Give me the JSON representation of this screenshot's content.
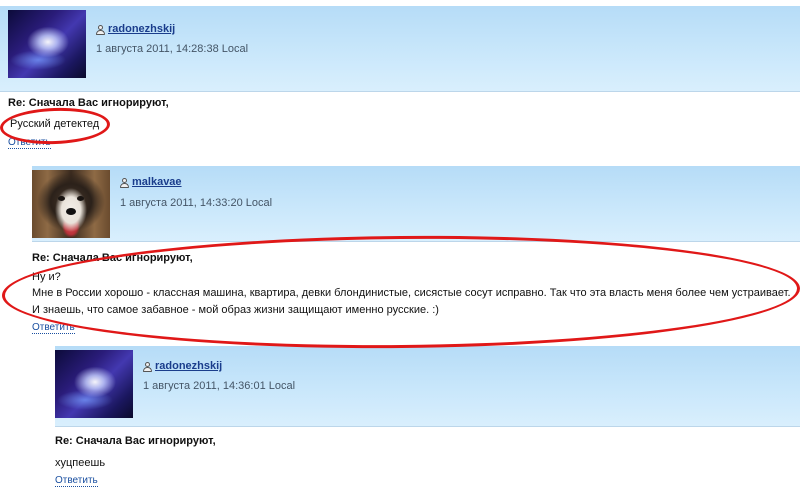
{
  "comments": [
    {
      "username": "radonezhskij",
      "timestamp": "1 августа 2011, 14:28:38 Local",
      "title": "Re: Сначала Вас игнорируют,",
      "body": [
        "Русский детектед"
      ],
      "reply": "Ответить",
      "avatar": "nebula-hand-avatar"
    },
    {
      "username": "malkavae",
      "timestamp": "1 августа 2011, 14:33:20 Local",
      "title": "Re: Сначала Вас игнорируют,",
      "body": [
        "Ну и?",
        "Мне в России хорошо - классная машина, квартира, девки блондинистые, сисястые сосут исправно. Так что эта власть меня более чем устраивает.",
        "И знаешь, что самое забавное - мой образ жизни защищают именно русские. :)"
      ],
      "reply": "Ответить",
      "avatar": "husky-dog-avatar"
    },
    {
      "username": "radonezhskij",
      "timestamp": "1 августа 2011, 14:36:01 Local",
      "title": "Re: Сначала Вас игнорируют,",
      "body": [
        "хуцпеешь"
      ],
      "reply": "Ответить",
      "avatar": "nebula-hand-avatar"
    }
  ],
  "colors": {
    "header_band": "#c2e3fa",
    "username": "#1a3d8c",
    "link": "#1a4fa0",
    "annotation": "#e01818"
  },
  "icons": {
    "user": "user-icon"
  }
}
